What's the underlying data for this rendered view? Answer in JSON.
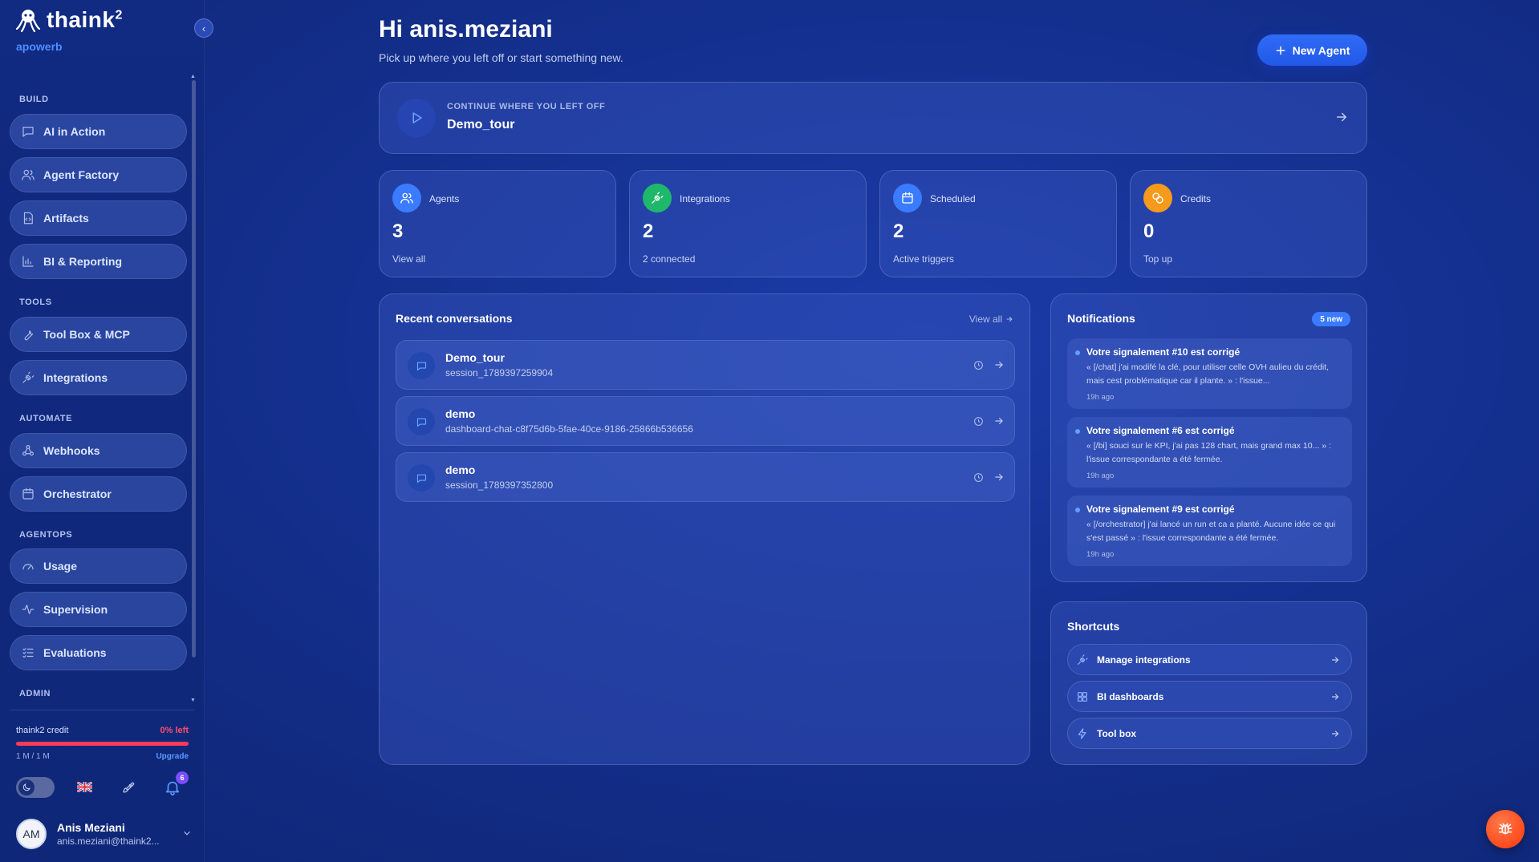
{
  "brand": {
    "name": "thaink",
    "superscript": "2",
    "org": "apowerb"
  },
  "sidebar": {
    "sections": [
      {
        "label": "BUILD"
      },
      {
        "label": "TOOLS"
      },
      {
        "label": "AUTOMATE"
      },
      {
        "label": "AGENTOPS"
      },
      {
        "label": "ADMIN"
      }
    ],
    "items": [
      {
        "label": "AI in Action",
        "icon": "chat-icon"
      },
      {
        "label": "Agent Factory",
        "icon": "users-icon"
      },
      {
        "label": "Artifacts",
        "icon": "file-code-icon"
      },
      {
        "label": "BI & Reporting",
        "icon": "bar-chart-icon"
      },
      {
        "label": "Tool Box & MCP",
        "icon": "wrench-icon"
      },
      {
        "label": "Integrations",
        "icon": "plug-icon"
      },
      {
        "label": "Webhooks",
        "icon": "webhook-icon"
      },
      {
        "label": "Orchestrator",
        "icon": "calendar-icon"
      },
      {
        "label": "Usage",
        "icon": "gauge-icon"
      },
      {
        "label": "Supervision",
        "icon": "pulse-icon"
      },
      {
        "label": "Evaluations",
        "icon": "checklist-icon"
      }
    ],
    "credit": {
      "label": "thaink2 credit",
      "percent_left": "0% left",
      "usage": "1 M / 1 M",
      "upgrade": "Upgrade",
      "fill_fraction": 1.0
    },
    "notifications_count": "6",
    "user": {
      "initials": "AM",
      "name": "Anis Meziani",
      "email": "anis.meziani@thaink2..."
    }
  },
  "header": {
    "greeting": "Hi anis.meziani",
    "subtitle": "Pick up where you left off or start something new.",
    "new_agent": "New Agent"
  },
  "continue": {
    "label": "CONTINUE WHERE YOU LEFT OFF",
    "title": "Demo_tour"
  },
  "stats": [
    {
      "label": "Agents",
      "value": "3",
      "sub": "View all",
      "color": "#3a7bff",
      "icon": "users-icon"
    },
    {
      "label": "Integrations",
      "value": "2",
      "sub": "2 connected",
      "color": "#1fb86a",
      "icon": "plug-icon"
    },
    {
      "label": "Scheduled",
      "value": "2",
      "sub": "Active triggers",
      "color": "#3a7bff",
      "icon": "calendar-icon"
    },
    {
      "label": "Credits",
      "value": "0",
      "sub": "Top up",
      "color": "#f59a1b",
      "icon": "coins-icon"
    }
  ],
  "recent": {
    "title": "Recent conversations",
    "view_all": "View all",
    "items": [
      {
        "title": "Demo_tour",
        "session": "session_1789397259904"
      },
      {
        "title": "demo",
        "session": "dashboard-chat-c8f75d6b-5fae-40ce-9186-25866b536656"
      },
      {
        "title": "demo",
        "session": "session_1789397352800"
      }
    ]
  },
  "notifications": {
    "title": "Notifications",
    "badge": "5 new",
    "items": [
      {
        "title": "Votre signalement #10 est corrigé",
        "body": "« [/chat] j'ai modifé la clé, pour utiliser celle OVH aulieu du crédit, mais cest problématique car il plante. » : l'issue...",
        "time": "19h ago"
      },
      {
        "title": "Votre signalement #6 est corrigé",
        "body": "« [/bi] souci sur le KPI, j'ai pas 128 chart, mais grand max 10... » : l'issue correspondante a été fermée.",
        "time": "19h ago"
      },
      {
        "title": "Votre signalement #9 est corrigé",
        "body": "« [/orchestrator] j'ai lancé un run et ca a planté. Aucune idée ce qui s'est passé » : l'issue correspondante a été fermée.",
        "time": "19h ago"
      }
    ]
  },
  "shortcuts": {
    "title": "Shortcuts",
    "items": [
      {
        "label": "Manage integrations",
        "icon": "plug-icon"
      },
      {
        "label": "BI dashboards",
        "icon": "grid-icon"
      },
      {
        "label": "Tool box",
        "icon": "bolt-icon"
      }
    ]
  }
}
